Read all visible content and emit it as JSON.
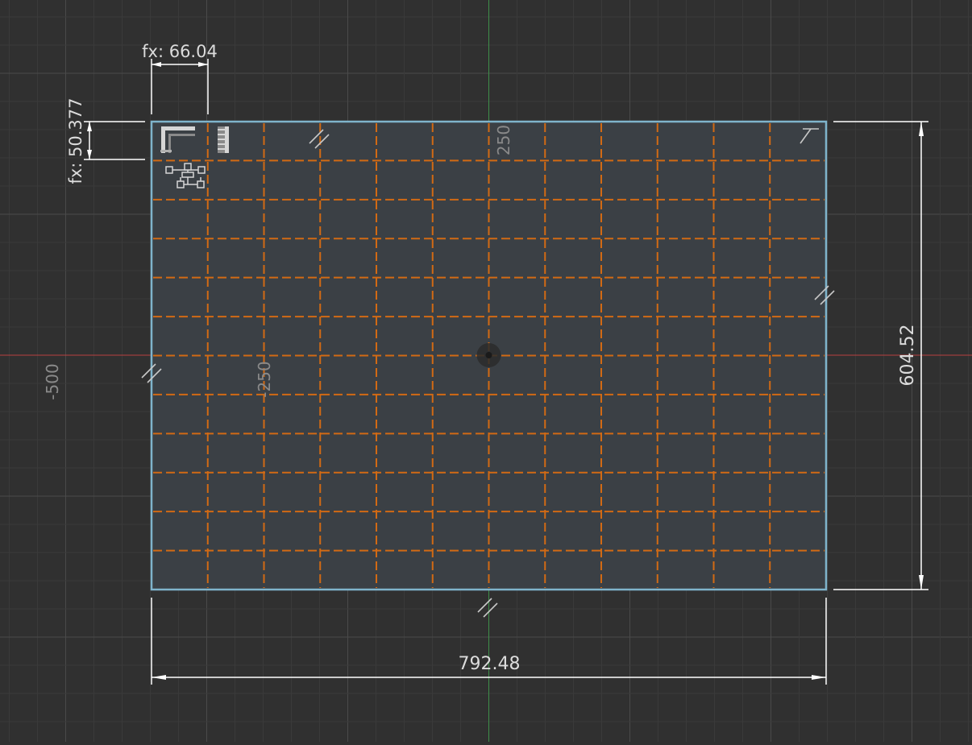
{
  "viewport": {
    "background": "#303030",
    "grid_minor_color": "#3a3a3a",
    "grid_major_color": "#4a4a4a",
    "axis_x_color": "#b94040",
    "axis_y_color": "#3f8f4a"
  },
  "sketch": {
    "rect_fill": "#3b4045",
    "rect_stroke": "#7fb4cc",
    "pattern_color": "#d26a14",
    "pattern_columns": 12,
    "pattern_rows": 12,
    "icon_names": [
      "corner-profile-icon",
      "edge-profile-icon",
      "hierarchy-icon",
      "corner-tick-icon",
      "parallel-constraint-icon",
      "center-point-icon"
    ]
  },
  "axis_labels": {
    "x_neg_500": "-500",
    "x_neg_250": "-250",
    "y_250": "250"
  },
  "dimensions": {
    "pattern_width": "fx: 66.04",
    "pattern_height": "fx: 50.377",
    "total_width": "792.48",
    "total_height": "604.52",
    "line_color": "#ffffff",
    "text_color": "#dcdcdc"
  }
}
